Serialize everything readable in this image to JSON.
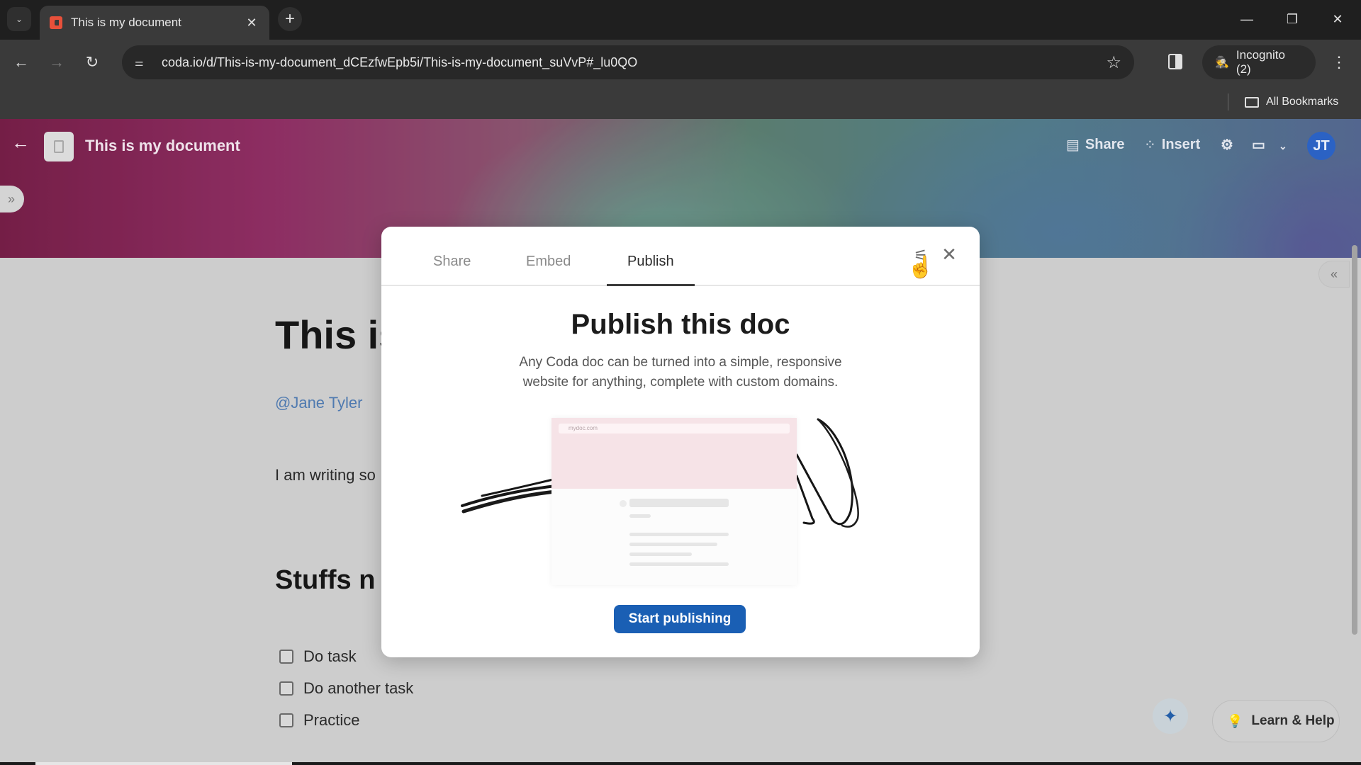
{
  "browser": {
    "tab": {
      "title": "This is my document",
      "favicon": "coda-logo-icon"
    },
    "url": "coda.io/d/This-is-my-document_dCEzfwEpb5i/This-is-my-document_suVvP#_lu0QO",
    "incognito_label": "Incognito (2)",
    "all_bookmarks_label": "All Bookmarks",
    "icons": {
      "tab_search": "chevron-down-icon",
      "close_tab": "close-icon",
      "new_tab": "plus-icon",
      "back": "arrow-left-icon",
      "forward": "arrow-right-icon",
      "reload": "reload-icon",
      "site_info": "tune-icon",
      "bookmark": "star-icon",
      "side_panel": "side-panel-icon",
      "incognito": "incognito-icon",
      "menu": "kebab-menu-icon",
      "minimize": "minimize-icon",
      "restore": "restore-icon",
      "close_window": "close-icon",
      "folder": "folder-icon"
    },
    "glyphs": {
      "tab_search": "⌄",
      "close": "✕",
      "new_tab": "+",
      "back": "←",
      "forward": "→",
      "reload": "↻",
      "site_info": "⚌",
      "star": "☆",
      "incognito": "🕵",
      "menu": "⋮",
      "minimize": "—",
      "restore": "❐"
    }
  },
  "doc": {
    "header": {
      "title": "This is my document",
      "back_glyph": "←",
      "share_label": "Share",
      "insert_label": "Insert",
      "share_glyph": "▤",
      "insert_glyph": "⁘",
      "settings_glyph": "⚙",
      "comments_glyph": "▭",
      "dropdown_glyph": "⌄",
      "avatar_initials": "JT",
      "avatar_color": "#2b62c4"
    },
    "expand_sidebar_glyph": "»",
    "collapse_panel_glyph": "«",
    "content": {
      "heading": "This is",
      "mention": "@Jane Tyler",
      "paragraph": "I am writing so",
      "subheading": "Stuffs n",
      "todos": [
        {
          "label": "Do task",
          "checked": false
        },
        {
          "label": "Do another task",
          "checked": false
        },
        {
          "label": "Practice",
          "checked": false
        }
      ]
    },
    "ai_button_glyph": "✦",
    "help_button": {
      "label": "Learn & Help",
      "glyph": "💡"
    }
  },
  "modal": {
    "tabs": [
      {
        "label": "Share",
        "active": false
      },
      {
        "label": "Embed",
        "active": false
      },
      {
        "label": "Publish",
        "active": true
      }
    ],
    "settings_glyph": "⚟",
    "close_glyph": "✕",
    "cursor_glyph": "☝",
    "heading": "Publish this doc",
    "description": "Any Coda doc can be turned into a simple, responsive website for anything, complete with custom domains.",
    "illustration": {
      "mock_url": "mydoc.com"
    },
    "primary_button": "Start publishing",
    "primary_color": "#1a5fb4"
  }
}
